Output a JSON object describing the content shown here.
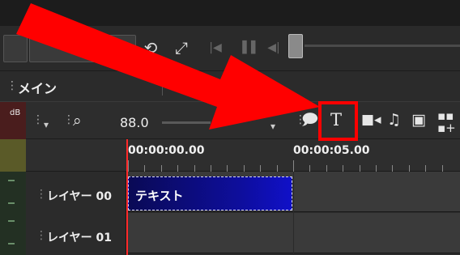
{
  "panel": {
    "tab_label": "メイン"
  },
  "timeline_toolbar": {
    "db_label": "dB",
    "zoom_value": "88.0",
    "text_tool_glyph": "T",
    "icons": [
      "grip-icon",
      "search-zoom-icon",
      "comment-icon",
      "text-icon",
      "video-camera-icon",
      "music-note-icon",
      "image-icon",
      "add-shape-icon"
    ]
  },
  "ruler": {
    "timecodes": [
      "00:00:00.00",
      "00:00:05.00"
    ]
  },
  "layers": [
    {
      "name": "レイヤー 00"
    },
    {
      "name": "レイヤー 01"
    }
  ],
  "clips": [
    {
      "label": "テキスト",
      "layer": "レイヤー 00"
    }
  ],
  "colors": {
    "annotation": "#ff0000",
    "playhead": "#ff2a2a",
    "clip": "#1010c8"
  }
}
